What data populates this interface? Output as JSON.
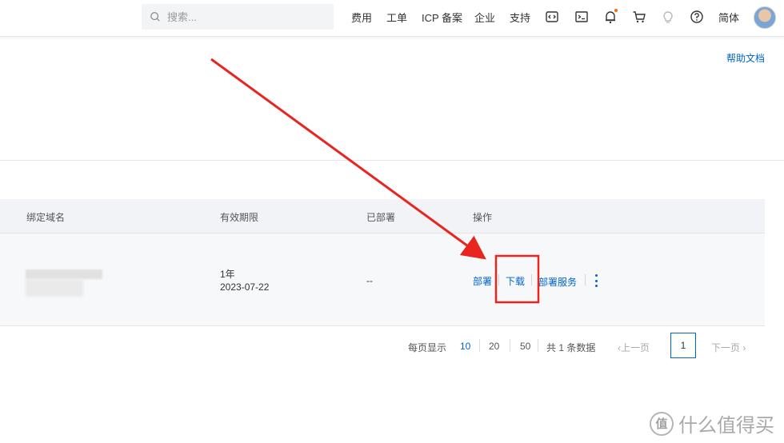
{
  "header": {
    "search_placeholder": "搜索...",
    "nav": [
      "费用",
      "工单",
      "ICP 备案",
      "企业",
      "支持"
    ],
    "lang": "简体",
    "icons": [
      "code-icon",
      "terminal-icon",
      "bell-icon",
      "cart-icon",
      "bulb-icon",
      "help-icon"
    ],
    "notification_dot_color": "#ff6a00"
  },
  "help_link": "帮助文档",
  "table": {
    "headers": [
      "绑定域名",
      "有效期限",
      "已部署",
      "操作"
    ],
    "row": {
      "validity_period": "1年",
      "validity_date": "2023-07-22",
      "deployed": "--",
      "actions": [
        "部署",
        "下载",
        "部署服务"
      ]
    }
  },
  "pagination": {
    "per_page_label": "每页显示",
    "sizes": [
      "10",
      "20",
      "50"
    ],
    "selected_size": "10",
    "total": "共 1 条数据",
    "prev": "上一页",
    "current_page": "1",
    "next": "下一页"
  },
  "watermark": {
    "logo_text": "值",
    "text": "什么值得买"
  },
  "colors": {
    "link": "#0064c8",
    "annotation": "#e8261f",
    "header_bg": "#f1f3f6"
  }
}
